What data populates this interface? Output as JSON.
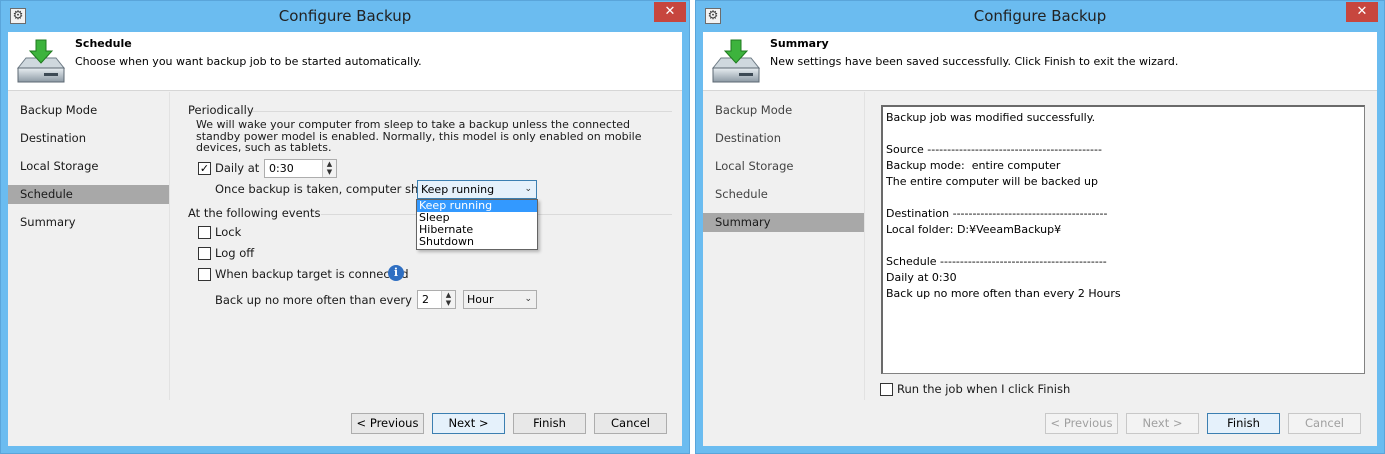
{
  "windows": [
    {
      "title": "Configure Backup",
      "close_label": "✕",
      "header": {
        "title": "Schedule",
        "subtitle": "Choose when you want backup job to be started automatically."
      },
      "nav": [
        "Backup Mode",
        "Destination",
        "Local Storage",
        "Schedule",
        "Summary"
      ],
      "selected_nav": "Schedule",
      "periodically": {
        "label": "Periodically",
        "description": "We will wake your computer from sleep to take a backup unless the connected standby power model is enabled. Normally, this model is only enabled on mobile devices, such as tablets.",
        "daily_label": "Daily at",
        "daily_checked": true,
        "daily_time": "0:30",
        "after_label": "Once backup is taken, computer should",
        "after_value": "Keep running",
        "after_options": [
          "Keep running",
          "Sleep",
          "Hibernate",
          "Shutdown"
        ]
      },
      "events": {
        "label": "At the following events",
        "lock": "Lock",
        "logoff": "Log off",
        "target": "When backup target is connected",
        "backup_limit_label": "Back up no more often than every",
        "backup_limit_value": "2",
        "backup_limit_unit": "Hour"
      },
      "buttons": {
        "previous": "< Previous",
        "next": "Next >",
        "finish": "Finish",
        "cancel": "Cancel"
      }
    },
    {
      "title": "Configure Backup",
      "close_label": "✕",
      "header": {
        "title": "Summary",
        "subtitle": "New settings have been saved successfully. Click Finish to exit the wizard."
      },
      "nav": [
        "Backup Mode",
        "Destination",
        "Local Storage",
        "Schedule",
        "Summary"
      ],
      "selected_nav": "Summary",
      "summary_lines": [
        "Backup job was modified successfully.",
        "",
        "Source --------------------------------------------",
        "Backup mode:  entire computer",
        "The entire computer will be backed up",
        "",
        "Destination ---------------------------------------",
        "Local folder: D:¥VeeamBackup¥",
        "",
        "Schedule ------------------------------------------",
        "Daily at 0:30",
        "Back up no more often than every 2 Hours"
      ],
      "run_job_label": "Run the job when I click Finish",
      "run_job_checked": false,
      "buttons": {
        "previous": "< Previous",
        "next": "Next >",
        "finish": "Finish",
        "cancel": "Cancel"
      }
    }
  ]
}
